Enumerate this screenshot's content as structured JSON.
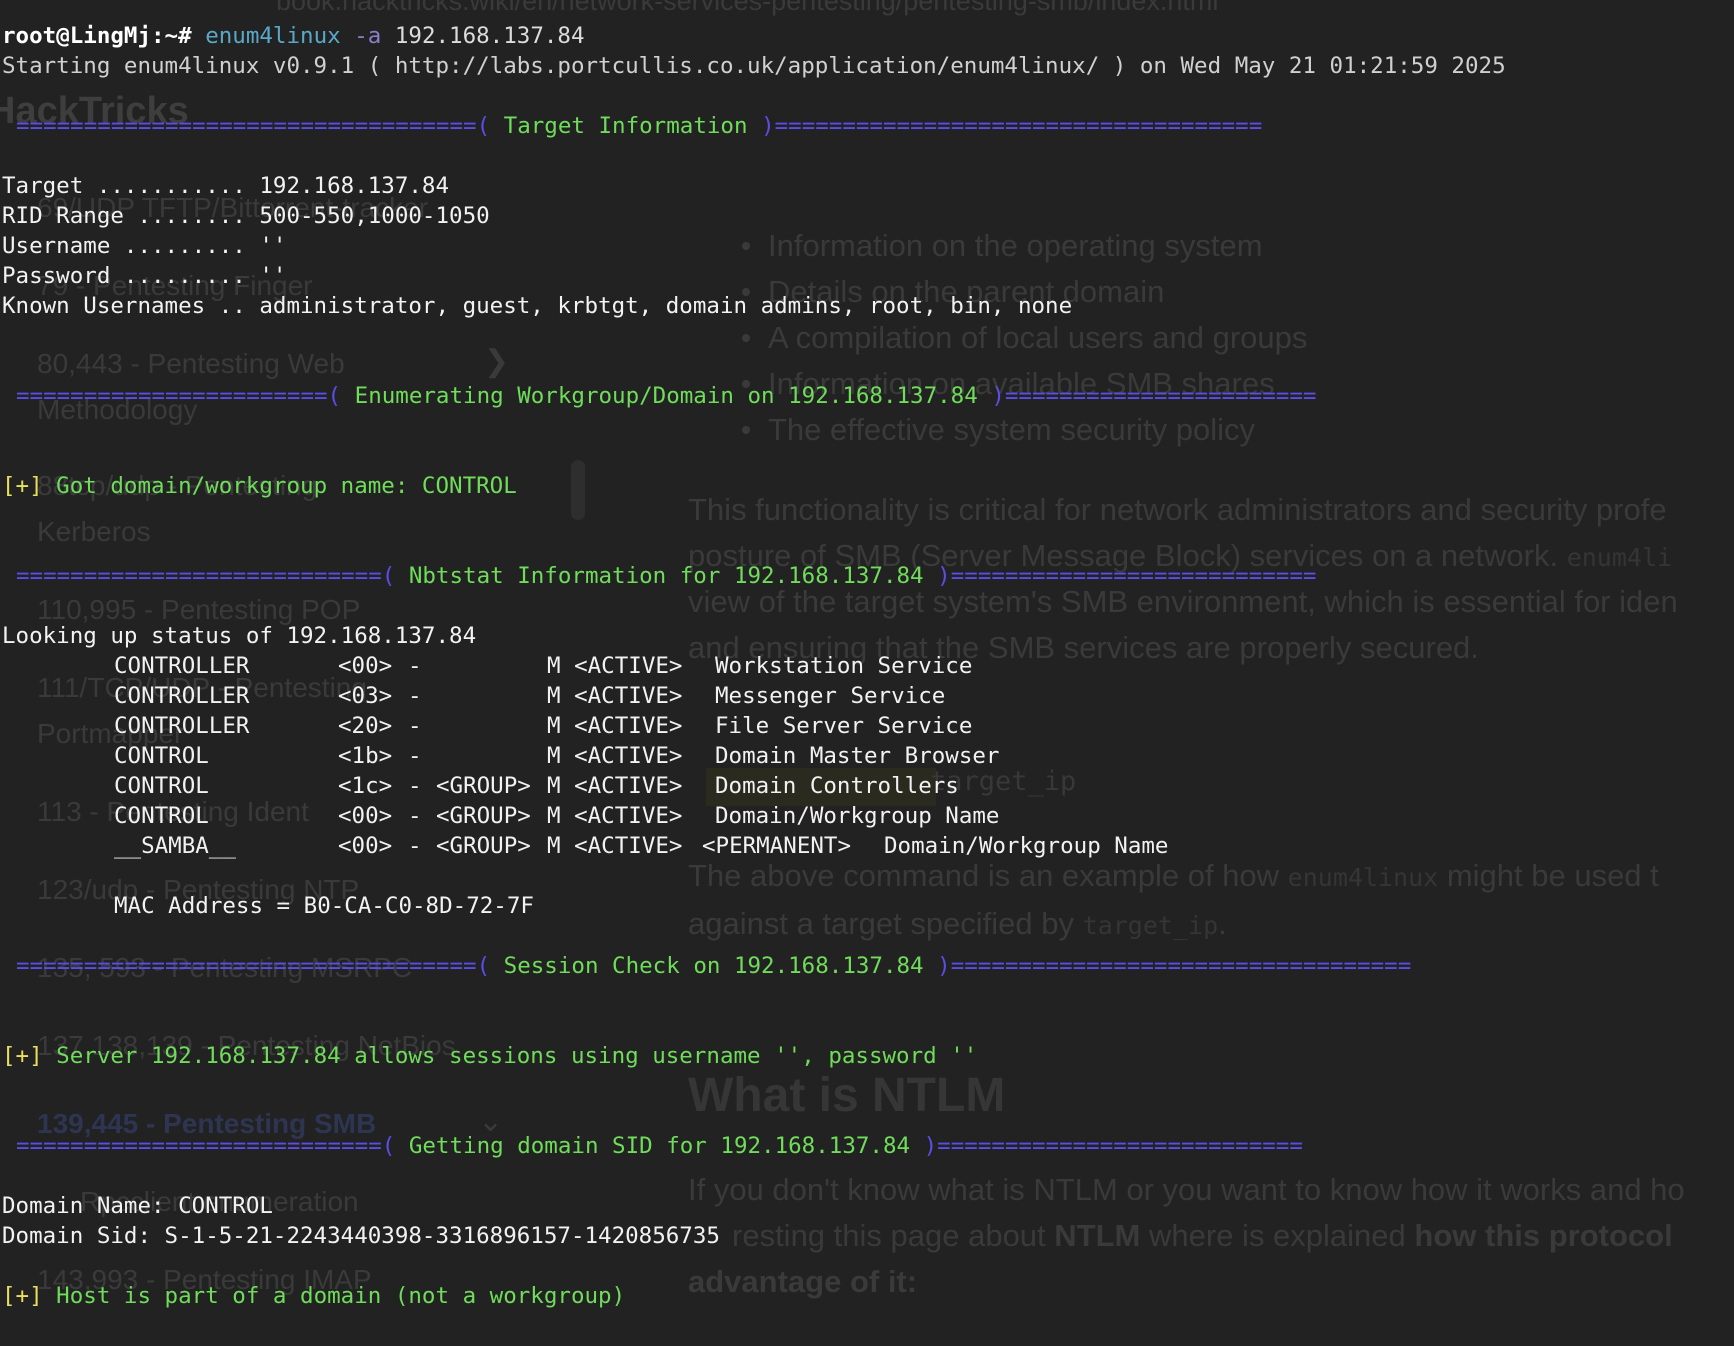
{
  "terminal": {
    "prompt": "root@LingMj:~# ",
    "command": "enum4linux",
    "flag": "-a",
    "argument": "192.168.137.84",
    "starting_line": "Starting enum4linux v0.9.1 ( http://labs.portcullis.co.uk/application/enum4linux/ ) on Wed May 21 01:21:59 2025",
    "sections": {
      "target_info": " Target Information ",
      "workgroup": " Enumerating Workgroup/Domain on 192.168.137.84 ",
      "nbtstat": " Nbtstat Information for 192.168.137.84 ",
      "session": " Session Check on 192.168.137.84 ",
      "domain_sid": " Getting domain SID for 192.168.137.84 "
    },
    "target_info": {
      "target": "Target ........... 192.168.137.84",
      "rid_range": "RID Range ........ 500-550,1000-1050",
      "username": "Username ......... ''",
      "password": "Password ......... ''",
      "known_usernames": "Known Usernames .. administrator, guest, krbtgt, domain admins, root, bin, none"
    },
    "plus_marker": "[+]",
    "workgroup_result": " Got domain/workgroup name: CONTROL",
    "nbtstat_lookup": "Looking up status of 192.168.137.84",
    "nbtstat_rows": [
      {
        "name": "CONTROLLER",
        "code": "<00>",
        "group": "",
        "flags": "M <ACTIVE>",
        "perm": "",
        "desc": "Workstation Service"
      },
      {
        "name": "CONTROLLER",
        "code": "<03>",
        "group": "",
        "flags": "M <ACTIVE>",
        "perm": "",
        "desc": "Messenger Service"
      },
      {
        "name": "CONTROLLER",
        "code": "<20>",
        "group": "",
        "flags": "M <ACTIVE>",
        "perm": "",
        "desc": "File Server Service"
      },
      {
        "name": "CONTROL",
        "code": "<1b>",
        "group": "",
        "flags": "M <ACTIVE>",
        "perm": "",
        "desc": "Domain Master Browser"
      },
      {
        "name": "CONTROL",
        "code": "<1c>",
        "group": "<GROUP>",
        "flags": "M <ACTIVE>",
        "perm": "",
        "desc": "Domain Controllers"
      },
      {
        "name": "CONTROL",
        "code": "<00>",
        "group": "<GROUP>",
        "flags": "M <ACTIVE>",
        "perm": "",
        "desc": "Domain/Workgroup Name"
      },
      {
        "name": "__SAMBA__",
        "code": "<00>",
        "group": "<GROUP>",
        "flags": "M <ACTIVE>",
        "perm": "<PERMANENT>",
        "desc": "Domain/Workgroup Name"
      }
    ],
    "mac_address": "MAC Address = B0-CA-C0-8D-72-7F",
    "session_result": " Server 192.168.137.84 allows sessions using username '', password ''",
    "domain_name": "Domain Name: CONTROL",
    "domain_sid": "Domain Sid: S-1-5-21-2243440398-3316896157-1420856735",
    "domain_result": " Host is part of a domain (not a workgroup)"
  },
  "background_page": {
    "url": "book.hacktricks.wiki/en/network-services-pentesting/pentesting-smb/index.html",
    "brand": "HackTricks",
    "nav_items": [
      "69/UDP TFTP/Bittorrent-tracker",
      "79 - Pentesting Finger",
      "80,443 - Pentesting Web",
      "Methodology",
      "88tcp/udp - Pentesting",
      "Kerberos",
      "110,995 - Pentesting POP",
      "111/TCP/UDP - Pentesting",
      "Portmapper",
      "113 - Pentesting Ident",
      "123/udp - Pentesting NTP",
      "135, 593 - Pentesting MSRPC",
      "137,138,139 - Pentesting NetBios",
      "139,445 - Pentesting SMB",
      "Rpcclient enumeration",
      "143,993 - Pentesting IMAP"
    ],
    "bullets": [
      "Information on the operating system",
      "Details on the parent domain",
      "A compilation of local users and groups",
      "Information on available SMB shares",
      "The effective system security policy"
    ],
    "para1": [
      "This functionality is critical for network administrators and security profe",
      "posture of SMB (Server Message Block) services on a network.",
      "view of the target system's SMB environment, which is essential for iden",
      "and ensuring that the SMB services are properly secured."
    ],
    "para1_code": "enum4li",
    "code_line": "target_ip",
    "para2_a": "The above command is an example of how",
    "para2_code": "enum4linux",
    "para2_b": "might be used t",
    "para2_c": "against a target specified by",
    "para2_code2": "target_ip",
    "para2_d": ".",
    "heading": "What is NTLM",
    "para3_a": "If you don't know what is NTLM or you want to know how it works and ho",
    "para3_b": "resting this page about",
    "para3_b_bold": "NTLM",
    "para3_c": "where is explained",
    "para3_c_bold": "how this protocol",
    "para3_d_bold": "advantage of it:"
  },
  "colors": {
    "background": "#222222",
    "separator": "#5a4ee8",
    "section_title": "#6fdc5a",
    "plus_marker": "#e8e05a",
    "command": "#5aa8c8"
  }
}
